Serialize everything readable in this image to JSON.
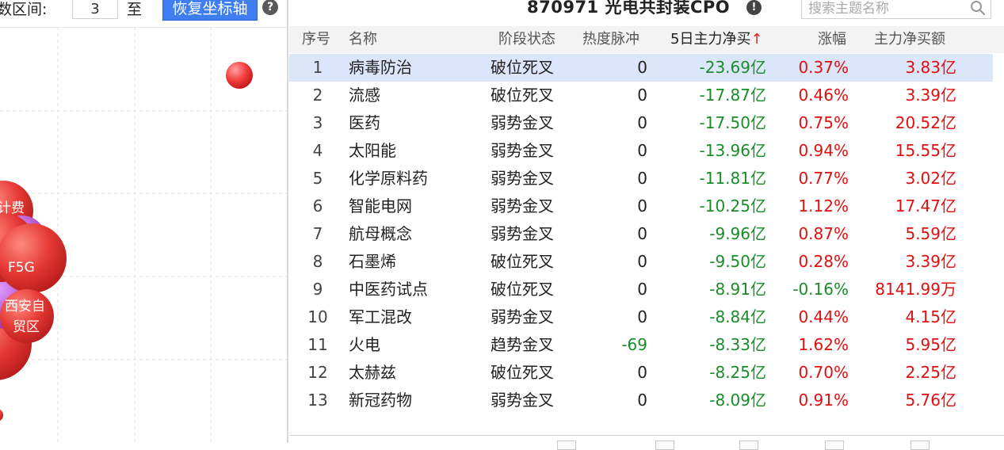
{
  "left_panel": {
    "range_label": "数区间:",
    "range_value": "3",
    "to_label": "至",
    "reset_button": "恢复坐标轴",
    "help_icon": "question-circle-icon",
    "bubbles": [
      {
        "label": "计费",
        "color": "#e53935"
      },
      {
        "label": "F5G",
        "color": "#e53935"
      },
      {
        "label": "西安自",
        "color": "#e53935"
      },
      {
        "label": "贸区",
        "color": "#e53935"
      }
    ]
  },
  "right_panel": {
    "title": "870971 光电共封装CPO",
    "info_icon": "info-circle-icon",
    "search": {
      "placeholder": "搜索主题名称",
      "icon": "search-icon"
    },
    "columns": {
      "idx": "序号",
      "name": "名称",
      "stage": "阶段状态",
      "heat": "热度脉冲",
      "net5": "5日主力净买",
      "sort_arrow": "↑",
      "change": "涨幅",
      "net": "主力净买额"
    },
    "rows": [
      {
        "idx": "1",
        "name": "病毒防治",
        "stage": "破位死叉",
        "heat": "0",
        "net5": "-23.69亿",
        "change": "0.37%",
        "net": "3.83亿",
        "selected": true
      },
      {
        "idx": "2",
        "name": "流感",
        "stage": "破位死叉",
        "heat": "0",
        "net5": "-17.87亿",
        "change": "0.46%",
        "net": "3.39亿"
      },
      {
        "idx": "3",
        "name": "医药",
        "stage": "弱势金叉",
        "heat": "0",
        "net5": "-17.50亿",
        "change": "0.75%",
        "net": "20.52亿"
      },
      {
        "idx": "4",
        "name": "太阳能",
        "stage": "弱势金叉",
        "heat": "0",
        "net5": "-13.96亿",
        "change": "0.94%",
        "net": "15.55亿"
      },
      {
        "idx": "5",
        "name": "化学原料药",
        "stage": "弱势金叉",
        "heat": "0",
        "net5": "-11.81亿",
        "change": "0.77%",
        "net": "3.02亿"
      },
      {
        "idx": "6",
        "name": "智能电网",
        "stage": "弱势金叉",
        "heat": "0",
        "net5": "-10.25亿",
        "change": "1.12%",
        "net": "17.47亿"
      },
      {
        "idx": "7",
        "name": "航母概念",
        "stage": "弱势金叉",
        "heat": "0",
        "net5": "-9.96亿",
        "change": "0.87%",
        "net": "5.59亿"
      },
      {
        "idx": "8",
        "name": "石墨烯",
        "stage": "破位死叉",
        "heat": "0",
        "net5": "-9.50亿",
        "change": "0.28%",
        "net": "3.39亿"
      },
      {
        "idx": "9",
        "name": "中医药试点",
        "stage": "破位死叉",
        "heat": "0",
        "net5": "-8.91亿",
        "change": "-0.16%",
        "net": "8141.99万"
      },
      {
        "idx": "10",
        "name": "军工混改",
        "stage": "弱势金叉",
        "heat": "0",
        "net5": "-8.84亿",
        "change": "0.44%",
        "net": "4.15亿"
      },
      {
        "idx": "11",
        "name": "火电",
        "stage": "趋势金叉",
        "heat": "-69",
        "net5": "-8.33亿",
        "change": "1.62%",
        "net": "5.95亿"
      },
      {
        "idx": "12",
        "name": "太赫兹",
        "stage": "破位死叉",
        "heat": "0",
        "net5": "-8.25亿",
        "change": "0.70%",
        "net": "2.25亿"
      },
      {
        "idx": "13",
        "name": "新冠药物",
        "stage": "弱势金叉",
        "heat": "0",
        "net5": "-8.09亿",
        "change": "0.91%",
        "net": "5.76亿"
      }
    ]
  },
  "colors": {
    "accent_button": "#3e7ef0",
    "selected_row": "#dce6fb",
    "negative": "#1a8c2a",
    "positive": "#e01010"
  }
}
